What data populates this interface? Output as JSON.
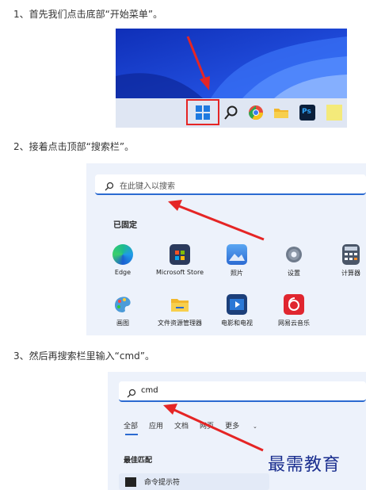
{
  "steps": [
    {
      "text": "1、首先我们点击底部“开始菜单”。"
    },
    {
      "text": "2、接着点击顶部“搜索栏”。"
    },
    {
      "text": "3、然后再搜索栏里输入“cmd”。"
    }
  ],
  "shot1": {
    "taskbar_icons": [
      "start-icon",
      "search-icon",
      "chrome-icon",
      "folder-icon",
      "photoshop-icon",
      "notes-icon"
    ],
    "photoshop_label": "Ps"
  },
  "shot2": {
    "search_placeholder": "在此键入以搜索",
    "pinned_title": "已固定",
    "apps": [
      {
        "label": "Edge",
        "icon": "edge-icon"
      },
      {
        "label": "Microsoft Store",
        "icon": "store-icon"
      },
      {
        "label": "照片",
        "icon": "photos-icon"
      },
      {
        "label": "设置",
        "icon": "settings-icon"
      },
      {
        "label": "计算器",
        "icon": "calculator-icon"
      },
      {
        "label": "画图",
        "icon": "paint-icon"
      },
      {
        "label": "文件资源管理器",
        "icon": "folder-icon"
      },
      {
        "label": "电影和电视",
        "icon": "movies-icon"
      },
      {
        "label": "网易云音乐",
        "icon": "music-icon"
      }
    ]
  },
  "shot3": {
    "search_value": "cmd",
    "tabs": [
      "全部",
      "应用",
      "文档",
      "网页",
      "更多"
    ],
    "best_match": "最佳匹配",
    "result_label": "命令提示符"
  },
  "watermark": "最需教育",
  "colors": {
    "arrow": "#e52525",
    "highlight": "#e52525",
    "accent": "#2b6ad1"
  }
}
